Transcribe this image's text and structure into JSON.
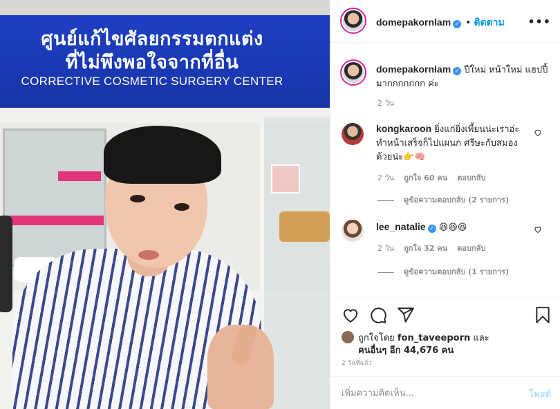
{
  "photo": {
    "sign_line_1": "ศูนย์แก้ไขศัลยกรรมตกแต่ง",
    "sign_line_2": "ที่ไม่พึงพอใจจากที่อื่น",
    "sign_english": "CORRECTIVE COSMETIC SURGERY CENTER"
  },
  "header": {
    "username": "domepakornlam",
    "verified": true,
    "follow_label": "ติดตาม",
    "separator": "•"
  },
  "caption": {
    "username": "domepakornlam",
    "text": "ปีใหม่ หน้าใหม่ แฮปปี้มากกกกกกก ค่ะ",
    "time": "2 วัน"
  },
  "comments": [
    {
      "username": "kongkaroon",
      "text": "ยิ่งแก่ยิ่งเพี้ยนน่ะเราอ่ะ ทำหน้าเสร็จก็ไปแผนก ศรีษะกับสมองด้วยน่ะ👉🧠",
      "time": "2 วัน",
      "likes": "ถูกใจ 60 คน",
      "reply_label": "ตอบกลับ",
      "view_replies": "ดูข้อความตอบกลับ (2 รายการ)"
    },
    {
      "username": "lee_natalie",
      "verified": true,
      "text": "😆😆😆",
      "time": "2 วัน",
      "likes": "ถูกใจ 32 คน",
      "reply_label": "ตอบกลับ",
      "view_replies": "ดูข้อความตอบกลับ (1 รายการ)"
    }
  ],
  "likes": {
    "prefix": "ถูกใจโดย",
    "user": "fon_taveeporn",
    "and": "และ",
    "others": "คนอื่นๆ อีก 44,676 คน"
  },
  "posted_ago": "2 วันที่แล้ว",
  "comment_input": {
    "placeholder": "เพิ่มความคิดเห็น...",
    "post_label": "โพสต์"
  },
  "icons": [
    "heart-icon",
    "comment-icon",
    "share-icon",
    "bookmark-icon",
    "more-icon",
    "verified-icon"
  ],
  "colors": {
    "link": "#0095f6",
    "verified": "#3897f0",
    "sign_blue": "#1d3fc2"
  }
}
